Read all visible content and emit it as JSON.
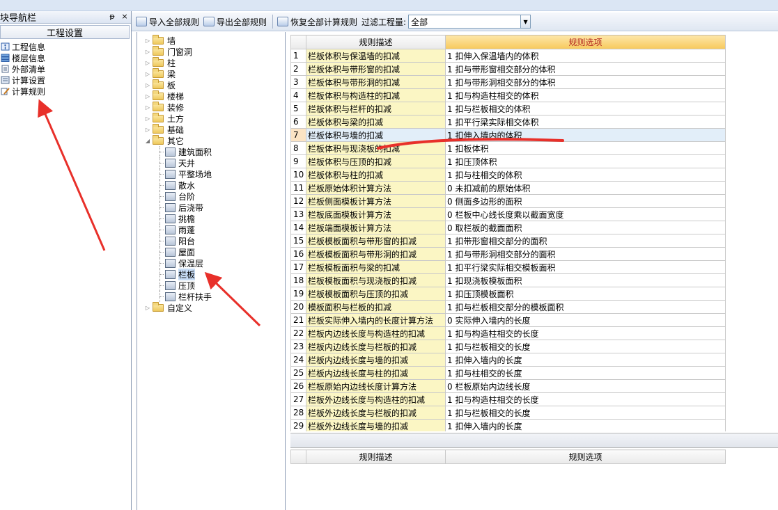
{
  "nav": {
    "title": "块导航栏",
    "pin": "ᵽ",
    "close": "×",
    "section": "工程设置",
    "items": [
      {
        "label": "工程信息",
        "icon": "info-icon"
      },
      {
        "label": "楼层信息",
        "icon": "floor-icon"
      },
      {
        "label": "外部清单",
        "icon": "list-icon"
      },
      {
        "label": "计算设置",
        "icon": "settings-icon"
      },
      {
        "label": "计算规则",
        "icon": "pencil-icon"
      }
    ]
  },
  "toolbar": {
    "import_label": "导入全部规则",
    "export_label": "导出全部规则",
    "restore_label": "恢复全部计算规则",
    "filter_label": "过滤工程量:",
    "filter_value": "全部"
  },
  "tree": {
    "folders_before": [
      "墙",
      "门窗洞",
      "柱",
      "梁",
      "板",
      "楼梯",
      "装修",
      "土方",
      "基础"
    ],
    "open_folder": "其它",
    "children": [
      "建筑面积",
      "天井",
      "平整场地",
      "散水",
      "台阶",
      "后浇带",
      "挑檐",
      "雨蓬",
      "阳台",
      "屋面",
      "保温层",
      "栏板",
      "压顶",
      "栏杆扶手"
    ],
    "selected_child": "栏板",
    "folders_after": [
      "自定义"
    ]
  },
  "grid": {
    "header_desc": "规则描述",
    "header_opt": "规则选项",
    "highlight_row": 7,
    "rows": [
      {
        "n": "1",
        "desc": "栏板体积与保温墙的扣减",
        "opt": "1 扣伸入保温墙内的体积"
      },
      {
        "n": "2",
        "desc": "栏板体积与带形窗的扣减",
        "opt": "1 扣与带形窗相交部分的体积"
      },
      {
        "n": "3",
        "desc": "栏板体积与带形洞的扣减",
        "opt": "1 扣与带形洞相交部分的体积"
      },
      {
        "n": "4",
        "desc": "栏板体积与构造柱的扣减",
        "opt": "1 扣与构造柱相交的体积"
      },
      {
        "n": "5",
        "desc": "栏板体积与栏杆的扣减",
        "opt": "1 扣与栏板相交的体积"
      },
      {
        "n": "6",
        "desc": "栏板体积与梁的扣减",
        "opt": "1 扣平行梁实际相交体积"
      },
      {
        "n": "7",
        "desc": "栏板体积与墙的扣减",
        "opt": "1 扣伸入墙内的体积"
      },
      {
        "n": "8",
        "desc": "栏板体积与现浇板的扣减",
        "opt": "1 扣板体积"
      },
      {
        "n": "9",
        "desc": "栏板体积与压顶的扣减",
        "opt": "1 扣压顶体积"
      },
      {
        "n": "10",
        "desc": "栏板体积与柱的扣减",
        "opt": "1 扣与柱相交的体积"
      },
      {
        "n": "11",
        "desc": "栏板原始体积计算方法",
        "opt": "0 未扣减前的原始体积"
      },
      {
        "n": "12",
        "desc": "栏板侧面模板计算方法",
        "opt": "0 侧面多边形的面积"
      },
      {
        "n": "13",
        "desc": "栏板底面模板计算方法",
        "opt": "0 栏板中心线长度乘以截面宽度"
      },
      {
        "n": "14",
        "desc": "栏板端面模板计算方法",
        "opt": "0 取栏板的截面面积"
      },
      {
        "n": "15",
        "desc": "栏板模板面积与带形窗的扣减",
        "opt": "1 扣带形窗相交部分的面积"
      },
      {
        "n": "16",
        "desc": "栏板模板面积与带形洞的扣减",
        "opt": "1 扣与带形洞相交部分的面积"
      },
      {
        "n": "17",
        "desc": "栏板模板面积与梁的扣减",
        "opt": "1  扣平行梁实际相交模板面积"
      },
      {
        "n": "18",
        "desc": "栏板模板面积与现浇板的扣减",
        "opt": "1  扣现浇板模板面积"
      },
      {
        "n": "19",
        "desc": "栏板模板面积与压顶的扣减",
        "opt": "1  扣压顶模板面积"
      },
      {
        "n": "20",
        "desc": "模板面积与栏板的扣减",
        "opt": "1 扣与栏板相交部分的模板面积"
      },
      {
        "n": "21",
        "desc": "栏板实际伸入墙内的长度计算方法",
        "opt": "0  实际伸入墙内的长度"
      },
      {
        "n": "22",
        "desc": "栏板内边线长度与构造柱的扣减",
        "opt": "1 扣与构造柱相交的长度"
      },
      {
        "n": "23",
        "desc": "栏板内边线长度与栏板的扣减",
        "opt": "1 扣与栏板相交的长度"
      },
      {
        "n": "24",
        "desc": "栏板内边线长度与墙的扣减",
        "opt": "1 扣伸入墙内的长度"
      },
      {
        "n": "25",
        "desc": "栏板内边线长度与柱的扣减",
        "opt": "1 扣与柱相交的长度"
      },
      {
        "n": "26",
        "desc": "栏板原始内边线长度计算方法",
        "opt": "0 栏板原始内边线长度"
      },
      {
        "n": "27",
        "desc": "栏板外边线长度与构造柱的扣减",
        "opt": "1 扣与构造柱相交的长度"
      },
      {
        "n": "28",
        "desc": "栏板外边线长度与栏板的扣减",
        "opt": "1 扣与栏板相交的长度"
      },
      {
        "n": "29",
        "desc": "栏板外边线长度与墙的扣减",
        "opt": "1 扣伸入墙内的长度"
      }
    ]
  },
  "grid2": {
    "header_desc": "规则描述",
    "header_opt": "规则选项"
  },
  "colors": {
    "annotation": "#e8302a",
    "desc_cell": "#fbf6c4",
    "opt_header": "#f7c95c"
  }
}
